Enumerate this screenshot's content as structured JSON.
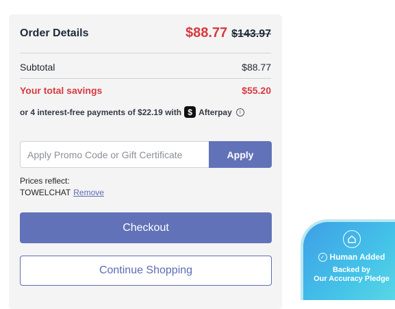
{
  "order": {
    "title": "Order Details",
    "price_now": "$88.77",
    "price_was": "$143.97",
    "subtotal_label": "Subtotal",
    "subtotal_value": "$88.77",
    "savings_label": "Your total savings",
    "savings_value": "$55.20",
    "afterpay_text": "or 4 interest-free payments of $22.19 with",
    "afterpay_badge": "$",
    "afterpay_brand": "Afterpay",
    "info_icon": "i"
  },
  "promo": {
    "placeholder": "Apply Promo Code or Gift Certificate",
    "value": "",
    "apply_label": "Apply"
  },
  "prices_reflect": {
    "label": "Prices reflect:",
    "code": "TOWELCHAT",
    "remove_label": "Remove"
  },
  "actions": {
    "checkout_label": "Checkout",
    "continue_label": "Continue Shopping"
  },
  "pledge": {
    "line1": "Human Added",
    "line2": "Backed by",
    "line3": "Our Accuracy Pledge",
    "icon": "house-icon"
  },
  "colors": {
    "accent": "#6272b8",
    "savings_red": "#d8393e",
    "card_bg": "#f4f4f5"
  }
}
